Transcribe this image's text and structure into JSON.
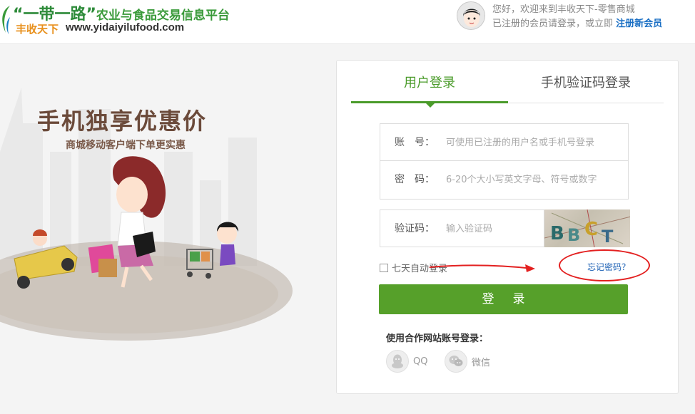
{
  "header": {
    "logo_title": "“一带一路”",
    "logo_subtitle": "农业与食品交易信息平台",
    "logo_brand": "丰收天下",
    "logo_url": "www.yidaiyilufood.com",
    "welcome_line1": "您好，欢迎来到丰收天下-零售商城",
    "welcome_line2": "已注册的会员请登录，或立即",
    "register_link": "注册新会员"
  },
  "promo": {
    "title": "手机独享优惠价",
    "subtitle": "商城移动客户端下单更实惠"
  },
  "login": {
    "tabs": [
      {
        "label": "用户登录",
        "active": true
      },
      {
        "label": "手机验证码登录",
        "active": false
      }
    ],
    "account_label": "账　号：",
    "account_placeholder": "可使用已注册的用户名或手机号登录",
    "password_label": "密　码：",
    "password_placeholder": "6-20个大小写英文字母、符号或数字",
    "captcha_label": "验证码：",
    "captcha_placeholder": "输入验证码",
    "captcha_text": "BBCT",
    "remember_label": "七天自动登录",
    "remember_checked": false,
    "forgot_label": "忘记密码？",
    "submit_label": "登录",
    "partner_title": "使用合作网站账号登录：",
    "partners": [
      {
        "label": "QQ",
        "icon": "qq-icon"
      },
      {
        "label": "微信",
        "icon": "wechat-icon"
      }
    ]
  },
  "colors": {
    "accent_green": "#56a02a",
    "tab_green": "#4a9b2a",
    "link_blue": "#1a5fb4",
    "annotation_red": "#e32020"
  }
}
